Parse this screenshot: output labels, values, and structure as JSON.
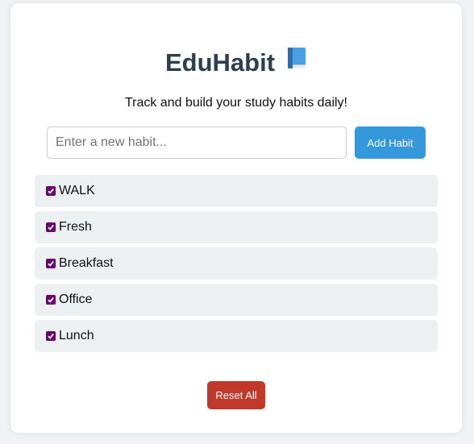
{
  "app": {
    "title": "EduHabit",
    "title_icon": "book-icon",
    "subtitle": "Track and build your study habits daily!"
  },
  "form": {
    "input_placeholder": "Enter a new habit...",
    "input_value": "",
    "add_label": "Add Habit"
  },
  "habits": [
    {
      "label": "WALK",
      "checked": true
    },
    {
      "label": "Fresh",
      "checked": true
    },
    {
      "label": "Breakfast",
      "checked": true
    },
    {
      "label": "Office",
      "checked": true
    },
    {
      "label": "Lunch",
      "checked": true
    }
  ],
  "actions": {
    "reset_label": "Reset All"
  },
  "colors": {
    "title": "#2c3e50",
    "add_button": "#3498db",
    "reset_button": "#c0392b",
    "habit_bg": "#ecf0f1",
    "checkbox": "#6a0072"
  }
}
